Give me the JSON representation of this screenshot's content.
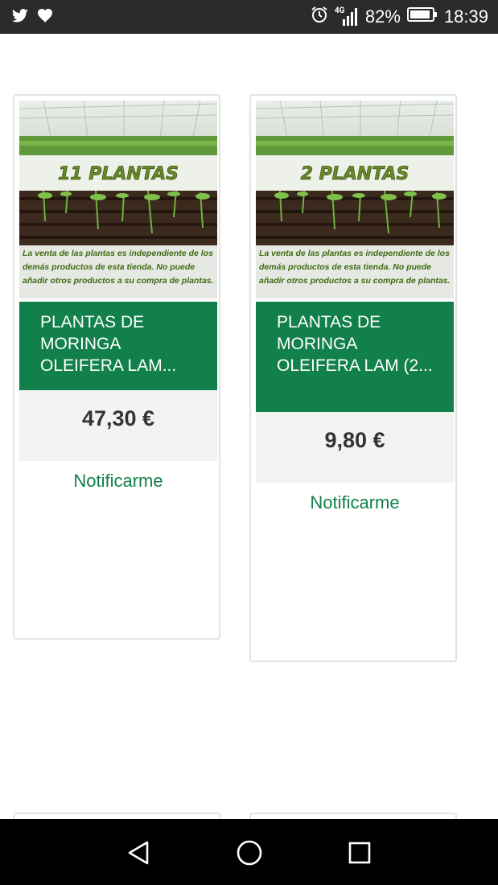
{
  "status_bar": {
    "network": "4G",
    "battery_percent": "82%",
    "time": "18:39",
    "icons": [
      "twitter-icon",
      "heart-icon",
      "alarm-icon",
      "signal-icon",
      "battery-icon"
    ]
  },
  "products": [
    {
      "image_banner": "11 PLANTAS",
      "image_caption": "La venta de las plantas es independiente de los demás productos de esta tienda. No puede añadir otros productos a su compra de plantas.",
      "title": "PLANTAS DE MORINGA OLEIFERA LAM...",
      "price": "47,30 €",
      "action": "Notificarme"
    },
    {
      "image_banner": "2 PLANTAS",
      "image_caption": "La venta de las plantas es independiente de los demás productos de esta tienda. No puede añadir otros productos a su compra de plantas.",
      "title": "PLANTAS DE MORINGA OLEIFERA LAM (2...",
      "price": "9,80 €",
      "action": "Notificarme"
    }
  ],
  "nav_bar": {
    "icons": [
      "back-icon",
      "home-icon",
      "recents-icon"
    ]
  },
  "colors": {
    "accent": "#11804a",
    "price_bg": "#f3f3f3",
    "status_bar": "#2b2b2b",
    "nav_bar": "#000000"
  }
}
